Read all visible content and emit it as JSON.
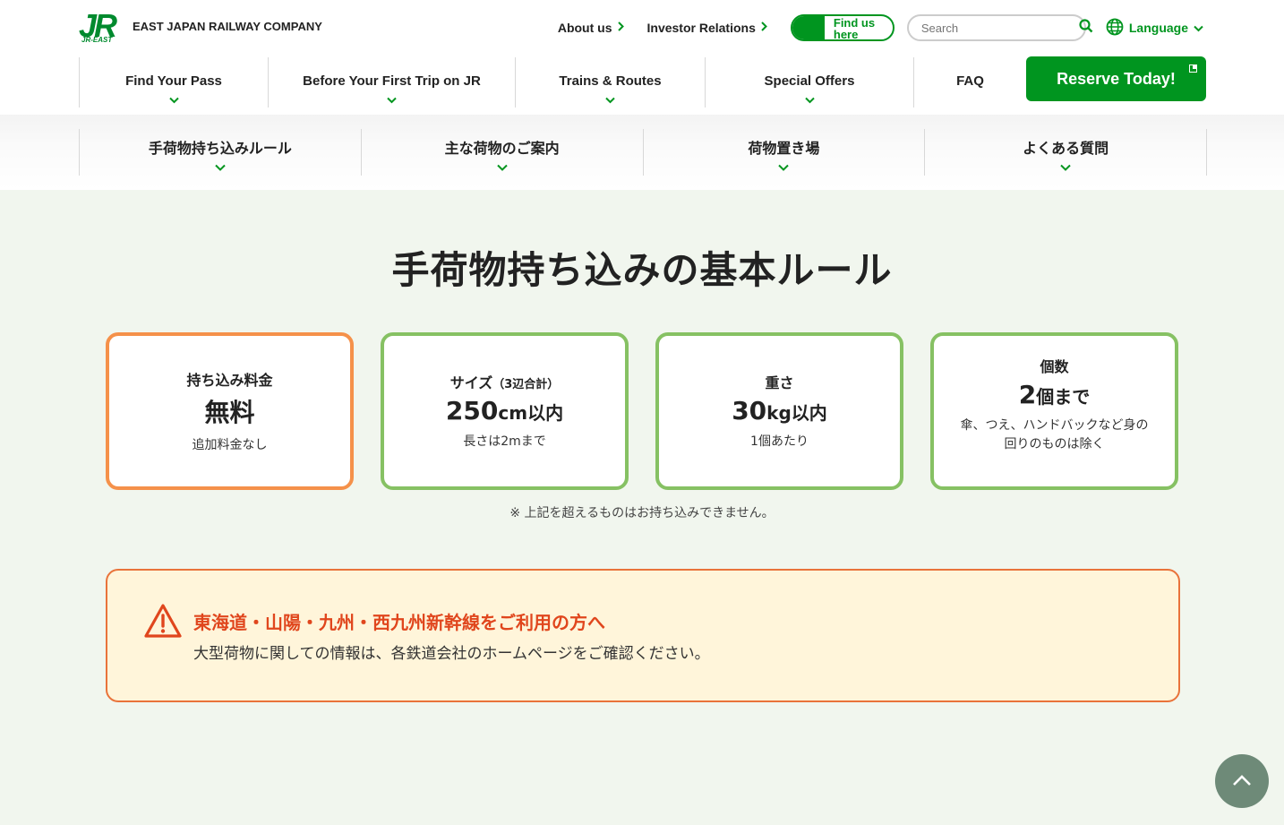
{
  "header": {
    "logo_mark": "JR",
    "logo_sub": "JR-EAST",
    "company": "EAST JAPAN RAILWAY COMPANY",
    "about": "About us",
    "investor": "Investor Relations",
    "findus": "Find us here",
    "search_placeholder": "Search",
    "language": "Language"
  },
  "mainnav": {
    "items": [
      "Find Your Pass",
      "Before Your First Trip on JR",
      "Trains & Routes",
      "Special Offers",
      "FAQ"
    ],
    "reserve": "Reserve Today!"
  },
  "subnav": {
    "items": [
      "手荷物持ち込みルール",
      "主な荷物のご案内",
      "荷物置き場",
      "よくある質問"
    ]
  },
  "page_title": "手荷物持ち込みの基本ルール",
  "cards": [
    {
      "label": "持ち込み料金",
      "value": "無料",
      "note": "追加料金なし"
    },
    {
      "label": "サイズ",
      "label_sub": "（3辺合計）",
      "value_num": "250",
      "value_unit": "cm",
      "value_suffix": "以内",
      "note": "長さは2mまで"
    },
    {
      "label": "重さ",
      "value_num": "30",
      "value_unit": "kg",
      "value_suffix": "以内",
      "note": "1個あたり"
    },
    {
      "label": "個数",
      "value_num": "2",
      "value_suffix": "個まで",
      "note": "傘、つえ、ハンドバックなど身の回りのものは除く"
    }
  ],
  "footnote": "※ 上記を超えるものはお持ち込みできません。",
  "notice": {
    "title": "東海道・山陽・九州・西九州新幹線をご利用の方へ",
    "body": "大型荷物に関しての情報は、各鉄道会社のホームページをご確認ください。"
  },
  "colors": {
    "brand_green": "#00951f",
    "card_green": "#86c163",
    "card_orange": "#f5914a",
    "notice_red": "#e0461d",
    "notice_bg": "#fff5da"
  },
  "icons": [
    "search-icon",
    "globe-icon",
    "chevron-down-icon",
    "chevron-right-icon",
    "warning-icon",
    "arrow-up-icon",
    "external-link-icon"
  ]
}
